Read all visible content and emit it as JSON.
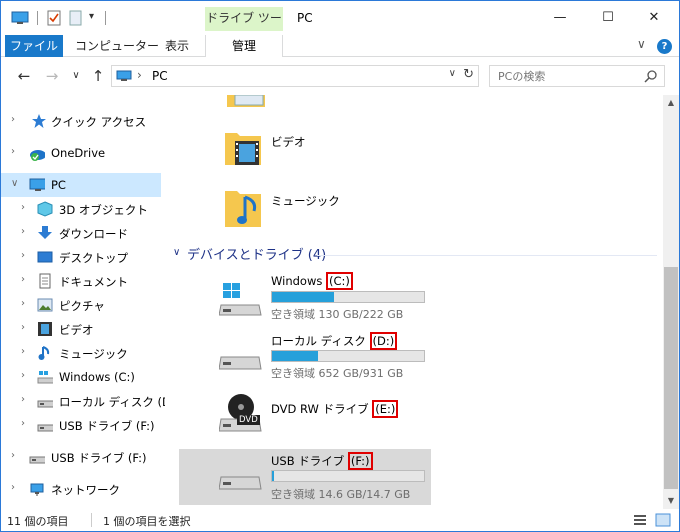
{
  "titlebar": {
    "title": "PC",
    "tool_tab_header": "ドライブ ツール",
    "minimize": "—",
    "maximize": "☐",
    "close": "✕"
  },
  "ribbon": {
    "file_tab": "ファイル",
    "tabs": [
      "コンピューター",
      "表示"
    ],
    "manage_tab": "管理",
    "expand_label": "∨",
    "help_label": "?"
  },
  "navigation": {
    "back": "←",
    "forward": "→",
    "recent": "∨",
    "up": "↑",
    "address_separator": "›",
    "address_text": "PC",
    "address_dropdown": "∨",
    "refresh": "↻",
    "search_placeholder": "PCの検索"
  },
  "nav_pane": {
    "items": [
      {
        "label": "クイック アクセス",
        "icon": "star-icon",
        "level": 0,
        "chevron": "›"
      },
      {
        "label": "OneDrive",
        "icon": "onedrive-icon",
        "level": 0,
        "chevron": "›"
      },
      {
        "label": "PC",
        "icon": "pc-icon",
        "level": 0,
        "chevron": "∨",
        "selected": true
      },
      {
        "label": "3D オブジェクト",
        "icon": "3d-objects-icon",
        "level": 1,
        "chevron": "›"
      },
      {
        "label": "ダウンロード",
        "icon": "download-icon",
        "level": 1,
        "chevron": "›"
      },
      {
        "label": "デスクトップ",
        "icon": "desktop-icon",
        "level": 1,
        "chevron": "›"
      },
      {
        "label": "ドキュメント",
        "icon": "documents-icon",
        "level": 1,
        "chevron": "›"
      },
      {
        "label": "ピクチャ",
        "icon": "pictures-icon",
        "level": 1,
        "chevron": "›"
      },
      {
        "label": "ビデオ",
        "icon": "video-icon",
        "level": 1,
        "chevron": "›"
      },
      {
        "label": "ミュージック",
        "icon": "music-icon",
        "level": 1,
        "chevron": "›"
      },
      {
        "label": "Windows (C:)",
        "icon": "windows-drive-icon",
        "level": 1,
        "chevron": "›"
      },
      {
        "label": "ローカル ディスク (D:)",
        "icon": "drive-icon",
        "level": 1,
        "chevron": "›"
      },
      {
        "label": "USB ドライブ (F:)",
        "icon": "usb-drive-icon",
        "level": 1,
        "chevron": "›"
      },
      {
        "label": "USB ドライブ (F:)",
        "icon": "usb-drive-icon",
        "level": 0,
        "chevron": "›"
      },
      {
        "label": "ネットワーク",
        "icon": "network-icon",
        "level": 0,
        "chevron": "›"
      }
    ]
  },
  "content": {
    "folders": [
      {
        "label": "ビデオ",
        "icon": "video-folder-icon"
      },
      {
        "label": "ミュージック",
        "icon": "music-folder-icon"
      }
    ],
    "group_header": "デバイスとドライブ (4)",
    "group_chevron": "∨",
    "drives": [
      {
        "name": "Windows ",
        "letter": "(C:)",
        "icon": "windows-drive-icon",
        "used_fraction": 0.41,
        "space": "空き領域 130 GB/222 GB"
      },
      {
        "name": "ローカル ディスク ",
        "letter": "(D:)",
        "icon": "drive-icon",
        "used_fraction": 0.3,
        "space": "空き領域 652 GB/931 GB"
      },
      {
        "name": "DVD RW ドライブ ",
        "letter": "(E:)",
        "icon": "dvd-drive-icon",
        "badge": "DVD"
      },
      {
        "name": "USB ドライブ ",
        "letter": "(F:)",
        "icon": "usb-drive-icon",
        "used_fraction": 0.01,
        "space": "空き領域 14.6 GB/14.7 GB",
        "selected": true
      }
    ]
  },
  "status_bar": {
    "item_count": "11 個の項目",
    "selected": "1 個の項目を選択"
  },
  "colors": {
    "accent": "#1979ca",
    "selection": "#cce8ff",
    "drive_fill": "#26a0da",
    "highlight_box": "#e00000",
    "tool_tab": "#dcf5c9"
  }
}
